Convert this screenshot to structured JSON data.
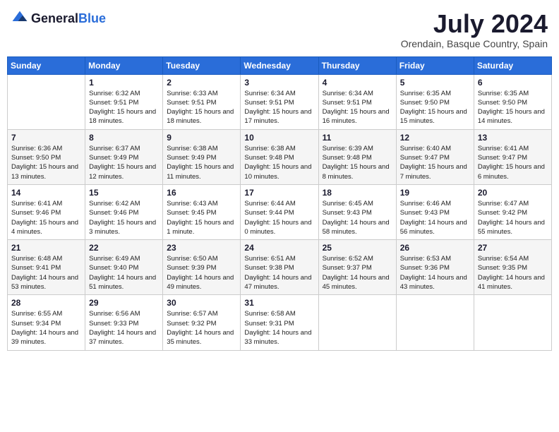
{
  "header": {
    "logo_general": "General",
    "logo_blue": "Blue",
    "title": "July 2024",
    "location": "Orendain, Basque Country, Spain"
  },
  "weekdays": [
    "Sunday",
    "Monday",
    "Tuesday",
    "Wednesday",
    "Thursday",
    "Friday",
    "Saturday"
  ],
  "weeks": [
    [
      {
        "day": "",
        "info": ""
      },
      {
        "day": "1",
        "info": "Sunrise: 6:32 AM\nSunset: 9:51 PM\nDaylight: 15 hours\nand 18 minutes."
      },
      {
        "day": "2",
        "info": "Sunrise: 6:33 AM\nSunset: 9:51 PM\nDaylight: 15 hours\nand 18 minutes."
      },
      {
        "day": "3",
        "info": "Sunrise: 6:34 AM\nSunset: 9:51 PM\nDaylight: 15 hours\nand 17 minutes."
      },
      {
        "day": "4",
        "info": "Sunrise: 6:34 AM\nSunset: 9:51 PM\nDaylight: 15 hours\nand 16 minutes."
      },
      {
        "day": "5",
        "info": "Sunrise: 6:35 AM\nSunset: 9:50 PM\nDaylight: 15 hours\nand 15 minutes."
      },
      {
        "day": "6",
        "info": "Sunrise: 6:35 AM\nSunset: 9:50 PM\nDaylight: 15 hours\nand 14 minutes."
      }
    ],
    [
      {
        "day": "7",
        "info": "Sunrise: 6:36 AM\nSunset: 9:50 PM\nDaylight: 15 hours\nand 13 minutes."
      },
      {
        "day": "8",
        "info": "Sunrise: 6:37 AM\nSunset: 9:49 PM\nDaylight: 15 hours\nand 12 minutes."
      },
      {
        "day": "9",
        "info": "Sunrise: 6:38 AM\nSunset: 9:49 PM\nDaylight: 15 hours\nand 11 minutes."
      },
      {
        "day": "10",
        "info": "Sunrise: 6:38 AM\nSunset: 9:48 PM\nDaylight: 15 hours\nand 10 minutes."
      },
      {
        "day": "11",
        "info": "Sunrise: 6:39 AM\nSunset: 9:48 PM\nDaylight: 15 hours\nand 8 minutes."
      },
      {
        "day": "12",
        "info": "Sunrise: 6:40 AM\nSunset: 9:47 PM\nDaylight: 15 hours\nand 7 minutes."
      },
      {
        "day": "13",
        "info": "Sunrise: 6:41 AM\nSunset: 9:47 PM\nDaylight: 15 hours\nand 6 minutes."
      }
    ],
    [
      {
        "day": "14",
        "info": "Sunrise: 6:41 AM\nSunset: 9:46 PM\nDaylight: 15 hours\nand 4 minutes."
      },
      {
        "day": "15",
        "info": "Sunrise: 6:42 AM\nSunset: 9:46 PM\nDaylight: 15 hours\nand 3 minutes."
      },
      {
        "day": "16",
        "info": "Sunrise: 6:43 AM\nSunset: 9:45 PM\nDaylight: 15 hours\nand 1 minute."
      },
      {
        "day": "17",
        "info": "Sunrise: 6:44 AM\nSunset: 9:44 PM\nDaylight: 15 hours\nand 0 minutes."
      },
      {
        "day": "18",
        "info": "Sunrise: 6:45 AM\nSunset: 9:43 PM\nDaylight: 14 hours\nand 58 minutes."
      },
      {
        "day": "19",
        "info": "Sunrise: 6:46 AM\nSunset: 9:43 PM\nDaylight: 14 hours\nand 56 minutes."
      },
      {
        "day": "20",
        "info": "Sunrise: 6:47 AM\nSunset: 9:42 PM\nDaylight: 14 hours\nand 55 minutes."
      }
    ],
    [
      {
        "day": "21",
        "info": "Sunrise: 6:48 AM\nSunset: 9:41 PM\nDaylight: 14 hours\nand 53 minutes."
      },
      {
        "day": "22",
        "info": "Sunrise: 6:49 AM\nSunset: 9:40 PM\nDaylight: 14 hours\nand 51 minutes."
      },
      {
        "day": "23",
        "info": "Sunrise: 6:50 AM\nSunset: 9:39 PM\nDaylight: 14 hours\nand 49 minutes."
      },
      {
        "day": "24",
        "info": "Sunrise: 6:51 AM\nSunset: 9:38 PM\nDaylight: 14 hours\nand 47 minutes."
      },
      {
        "day": "25",
        "info": "Sunrise: 6:52 AM\nSunset: 9:37 PM\nDaylight: 14 hours\nand 45 minutes."
      },
      {
        "day": "26",
        "info": "Sunrise: 6:53 AM\nSunset: 9:36 PM\nDaylight: 14 hours\nand 43 minutes."
      },
      {
        "day": "27",
        "info": "Sunrise: 6:54 AM\nSunset: 9:35 PM\nDaylight: 14 hours\nand 41 minutes."
      }
    ],
    [
      {
        "day": "28",
        "info": "Sunrise: 6:55 AM\nSunset: 9:34 PM\nDaylight: 14 hours\nand 39 minutes."
      },
      {
        "day": "29",
        "info": "Sunrise: 6:56 AM\nSunset: 9:33 PM\nDaylight: 14 hours\nand 37 minutes."
      },
      {
        "day": "30",
        "info": "Sunrise: 6:57 AM\nSunset: 9:32 PM\nDaylight: 14 hours\nand 35 minutes."
      },
      {
        "day": "31",
        "info": "Sunrise: 6:58 AM\nSunset: 9:31 PM\nDaylight: 14 hours\nand 33 minutes."
      },
      {
        "day": "",
        "info": ""
      },
      {
        "day": "",
        "info": ""
      },
      {
        "day": "",
        "info": ""
      }
    ]
  ]
}
